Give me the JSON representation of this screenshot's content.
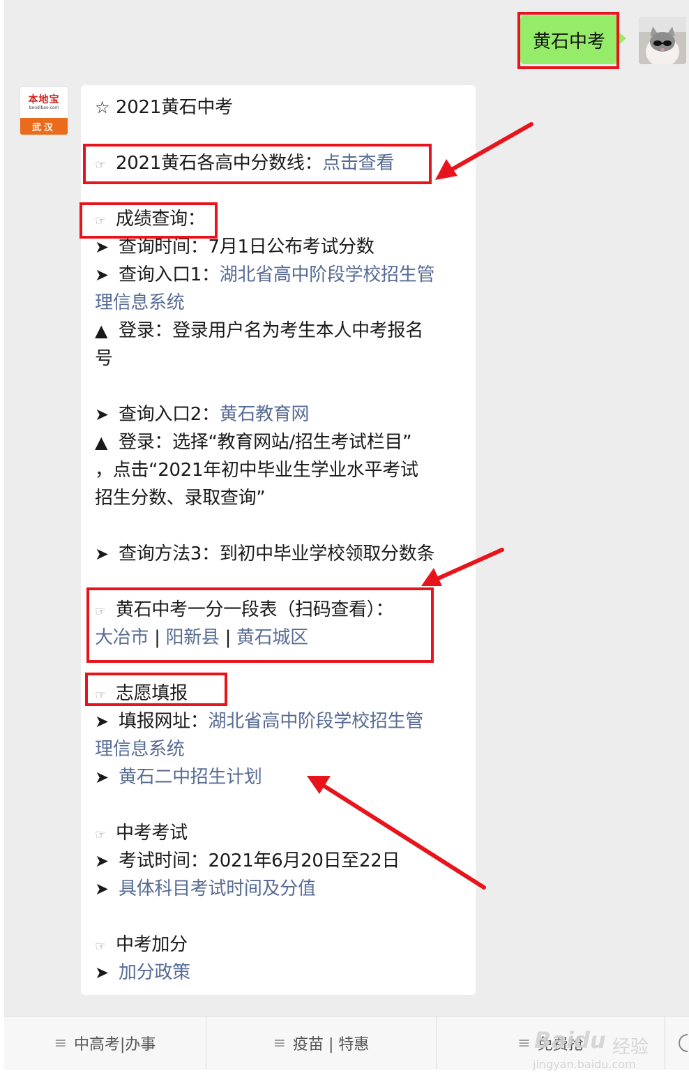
{
  "outgoing": {
    "text": "黄石中考"
  },
  "avatar_bot": {
    "brand": "本地宝",
    "site": "bendibao.com",
    "city": "武汉"
  },
  "message": {
    "title": "2021黄石中考",
    "l1": {
      "text": "2021黄石各高中分数线：",
      "link": "点击查看"
    },
    "h_query": "成绩查询：",
    "time": "查询时间：7月1日公布考试分数",
    "entry1": {
      "text": "查询入口1：",
      "link_a": "湖北省高中阶段学校招生管",
      "link_b": "理信息系统"
    },
    "login1_a": "登录：登录用户名为考生本人中考报名",
    "login1_b": "号",
    "entry2": {
      "text": "查询入口2：",
      "link": "黄石教育网"
    },
    "login2_a": "登录：选择“教育网站/招生考试栏目”",
    "login2_b": "，点击“2021年初中毕业生学业水平考试",
    "login2_c": "招生分数、录取查询”",
    "method3": "查询方法3：到初中毕业学校领取分数条",
    "h_table": "黄石中考一分一段表（扫码查看）：",
    "tables": [
      "大冶市",
      "阳新县",
      "黄石城区"
    ],
    "sep": "|",
    "h_fill": "志愿填报",
    "fill_site": {
      "text": "填报网址：",
      "link_a": "湖北省高中阶段学校招生管",
      "link_b": "理信息系统"
    },
    "plan_link": "黄石二中招生计划",
    "h_exam": "中考考试",
    "exam_time": "考试时间：2021年6月20日至22日",
    "exam_link": "具体科目考试时间及分值",
    "h_bonus": "中考加分",
    "bonus_link": "加分政策"
  },
  "menu": {
    "items": [
      "中高考|办事",
      "疫苗 | 特惠",
      "免费抢"
    ]
  },
  "watermark": {
    "brand": "Baidu",
    "cn": "经验",
    "url": "jingyan.baidu.com"
  },
  "colors": {
    "link": "#576b95",
    "highlight": "#e8141b",
    "outgoing_bubble": "#95ec69"
  },
  "icons": {
    "bullet_arrow": "➤",
    "triangle": "▲",
    "star": "☆",
    "hand": "☞",
    "menu": "≡"
  }
}
